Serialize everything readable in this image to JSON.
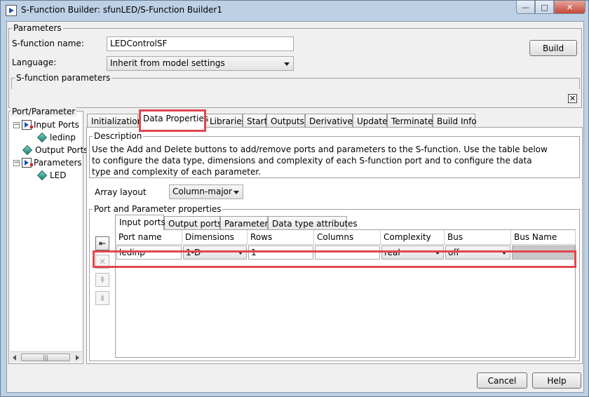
{
  "window": {
    "title": "S-Function Builder: sfunLED/S-Function Builder1",
    "controls": {
      "minimize": "—",
      "maximize": "□",
      "close": "✕"
    }
  },
  "parameters": {
    "group_title": "Parameters",
    "sfunction_name_label": "S-function name:",
    "sfunction_name_value": "LEDControlSF",
    "language_label": "Language:",
    "language_value": "Inherit from model settings",
    "sfunction_parameters_label": "S-function parameters",
    "build_label": "Build",
    "close_glyph": "✕"
  },
  "tree": {
    "title": "Port/Parameter",
    "items": [
      {
        "label": "Input Ports",
        "expander": "−"
      },
      {
        "label": "ledinp"
      },
      {
        "label": "Output Ports"
      },
      {
        "label": "Parameters",
        "expander": "−"
      },
      {
        "label": "LED"
      }
    ],
    "scroll_grip": "|||"
  },
  "tabs": [
    {
      "label": "Initialization"
    },
    {
      "label": "Data Properties"
    },
    {
      "label": "Libraries"
    },
    {
      "label": "Start"
    },
    {
      "label": "Outputs"
    },
    {
      "label": "Derivatives"
    },
    {
      "label": "Update"
    },
    {
      "label": "Terminate"
    },
    {
      "label": "Build Info"
    }
  ],
  "description": {
    "title": "Description",
    "lines": [
      "Use the Add and Delete buttons to add/remove ports and parameters to the S-function. Use the table below",
      "to configure the data type, dimensions and complexity of each S-function port and to configure the data",
      "type and complexity of each parameter."
    ]
  },
  "array_layout": {
    "label": "Array layout",
    "value": "Column-major"
  },
  "port_props": {
    "title": "Port and Parameter properties",
    "subtabs": [
      {
        "label": "Input ports"
      },
      {
        "label": "Output ports"
      },
      {
        "label": "Parameters"
      },
      {
        "label": "Data type attributes"
      }
    ],
    "side_buttons": {
      "add": "⇤",
      "delete": "✕",
      "move_up": "⇞",
      "move_down": "⇟"
    },
    "columns": [
      "Port name",
      "Dimensions",
      "Rows",
      "Columns",
      "Complexity",
      "Bus",
      "Bus Name"
    ],
    "rows": [
      {
        "port_name": "ledinp",
        "dimensions": "1-D",
        "rows": "1",
        "columns": "",
        "complexity": "real",
        "bus": "off",
        "bus_name": ""
      }
    ]
  },
  "footer": {
    "cancel_label": "Cancel",
    "help_label": "Help"
  }
}
